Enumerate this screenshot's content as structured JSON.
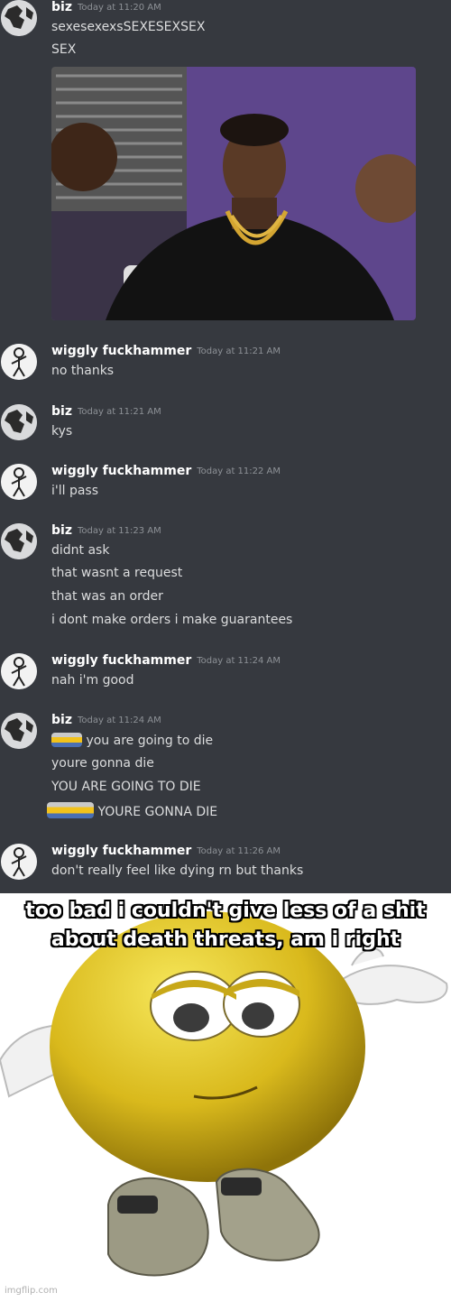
{
  "messages": [
    {
      "author": "biz",
      "timestamp": "Today at 11:20 AM",
      "lines": [
        "sexesexexsSEXESEXSEX",
        "SEX"
      ]
    },
    {
      "author": "wiggly fuckhammer",
      "timestamp": "Today at 11:21 AM",
      "lines": [
        "no thanks"
      ]
    },
    {
      "author": "biz",
      "timestamp": "Today at 11:21 AM",
      "lines": [
        "kys"
      ]
    },
    {
      "author": "wiggly fuckhammer",
      "timestamp": "Today at 11:22 AM",
      "lines": [
        "i'll pass"
      ]
    },
    {
      "author": "biz",
      "timestamp": "Today at 11:23 AM",
      "lines": [
        "didnt ask",
        "that wasnt a request",
        "that was an order",
        "i dont make orders i make guarantees"
      ]
    },
    {
      "author": "wiggly fuckhammer",
      "timestamp": "Today at 11:24 AM",
      "lines": [
        "nah i'm good"
      ]
    },
    {
      "author": "biz",
      "timestamp": "Today at 11:24 AM",
      "lines": [
        "you are going to die",
        "youre gonna die",
        "YOU ARE GOING TO DIE",
        "YOURE GONNA DIE"
      ]
    },
    {
      "author": "wiggly fuckhammer",
      "timestamp": "Today at 11:26 AM",
      "lines": [
        "don't really feel like dying rn but thanks"
      ]
    }
  ],
  "meme": {
    "caption": "too bad i couldn't give less of a shit about death threats, am i right",
    "watermark": "imgflip.com"
  }
}
